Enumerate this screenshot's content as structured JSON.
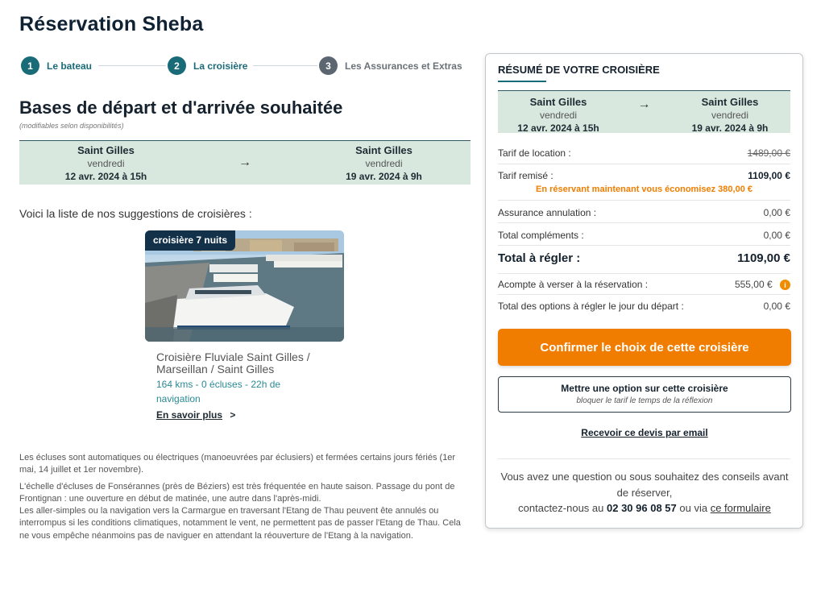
{
  "page": {
    "title": "Réservation Sheba"
  },
  "stepper": {
    "steps": [
      {
        "num": "1",
        "label": "Le bateau"
      },
      {
        "num": "2",
        "label": "La croisière"
      },
      {
        "num": "3",
        "label": "Les Assurances et Extras"
      }
    ]
  },
  "section": {
    "title": "Bases de départ et d'arrivée souhaitée",
    "subtitle": "(modifiables selon disponibilités)"
  },
  "route": {
    "from": {
      "city": "Saint Gilles",
      "day": "vendredi",
      "date": "12 avr. 2024 à 15h"
    },
    "arrow": "→",
    "to": {
      "city": "Saint Gilles",
      "day": "vendredi",
      "date": "19 avr. 2024 à 9h"
    }
  },
  "suggestions": {
    "intro": "Voici la liste de nos suggestions de croisières :",
    "cruise": {
      "badge": "croisière 7 nuits",
      "name": "Croisière Fluviale Saint Gilles / Marseillan / Saint Gilles",
      "meta": "164 kms - 0 écluses - 22h de navigation",
      "more_label": "En savoir plus",
      "more_arrow": ">"
    }
  },
  "notes": [
    "Les écluses sont automatiques ou électriques (manoeuvrées par éclusiers) et fermées certains jours fériés (1er mai, 14 juillet et 1er novembre).",
    "L'échelle d'écluses de Fonsérannes (près de Béziers) est très fréquentée en haute saison. Passage du pont de Frontignan : une ouverture en début de matinée, une autre dans l'après-midi.",
    "Les aller-simples ou la navigation vers la Carmargue en traversant l'Etang de Thau peuvent ête annulés ou interrompus si les conditions climatiques, notamment le vent, ne permettent pas de passer l'Etang de Thau. Cela ne vous empêche néanmoins pas de naviguer en attendant la réouverture de l'Etang à la navigation."
  ],
  "summary": {
    "title": "RÉSUMÉ DE VOTRE CROISIÈRE",
    "rental_label": "Tarif de location :",
    "rental_value": "1489,00 €",
    "discount_label": "Tarif remisé :",
    "discount_value": "1109,00 €",
    "savings": "En réservant maintenant vous économisez 380,00 €",
    "insurance_label": "Assurance annulation :",
    "insurance_value": "0,00 €",
    "extras_label": "Total compléments :",
    "extras_value": "0,00 €",
    "total_label": "Total à régler :",
    "total_value": "1109,00 €",
    "deposit_label": "Acompte à verser à la réservation :",
    "deposit_value": "555,00 €",
    "deposit_info": "i",
    "options_label": "Total des options à régler le jour du départ :",
    "options_value": "0,00 €",
    "confirm_button": "Confirmer le choix de cette croisière",
    "option_button_title": "Mettre une option sur cette croisière",
    "option_button_sub": "bloquer le tarif le temps de la réflexion",
    "email_link": "Recevoir ce devis par email",
    "contact_line1": "Vous avez une question ou sous souhaitez des conseils avant de réserver,",
    "contact_prefix": "contactez-nous au",
    "contact_phone": "02 30 96 08 57",
    "contact_mid": "ou via",
    "contact_form": "ce formulaire"
  },
  "colors": {
    "accent": "#1a6b78",
    "cta": "#f07d00",
    "route_bg": "#d8e8de",
    "navy": "#13324a"
  }
}
